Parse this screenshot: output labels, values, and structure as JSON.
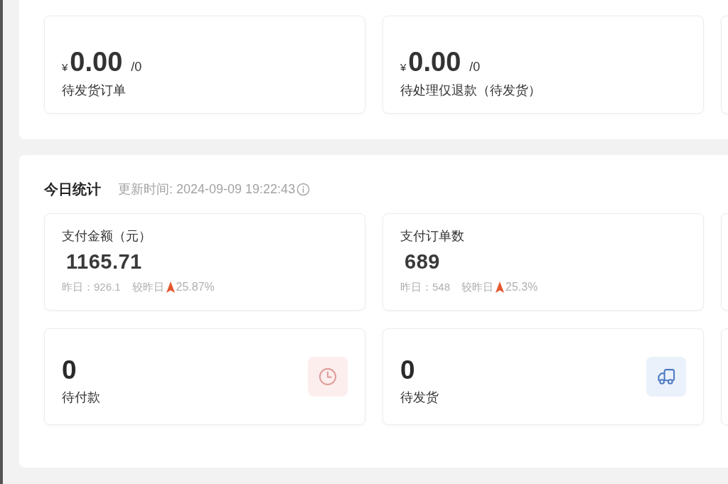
{
  "pending_cards": [
    {
      "currency": "¥",
      "amount": "0.00",
      "count": "/0",
      "label": "待发货订单"
    },
    {
      "currency": "¥",
      "amount": "0.00",
      "count": "/0",
      "label": "待处理仅退款（待发货）"
    }
  ],
  "today_stats": {
    "title": "今日统计",
    "updated": "更新时间: 2024-09-09 19:22:43",
    "metrics": [
      {
        "label": "支付金额（元）",
        "value": "1165.71",
        "yesterday": "昨日：926.1",
        "compare_label": "较昨日",
        "rising": true,
        "change": "25.87%"
      },
      {
        "label": "支付订单数",
        "value": "689",
        "yesterday": "昨日：548",
        "compare_label": "较昨日",
        "rising": true,
        "change": "25.3%"
      }
    ],
    "status_cards": [
      {
        "kind": "clock",
        "value": "0",
        "label": "待付款"
      },
      {
        "kind": "truck",
        "value": "0",
        "label": "待发货"
      }
    ]
  }
}
